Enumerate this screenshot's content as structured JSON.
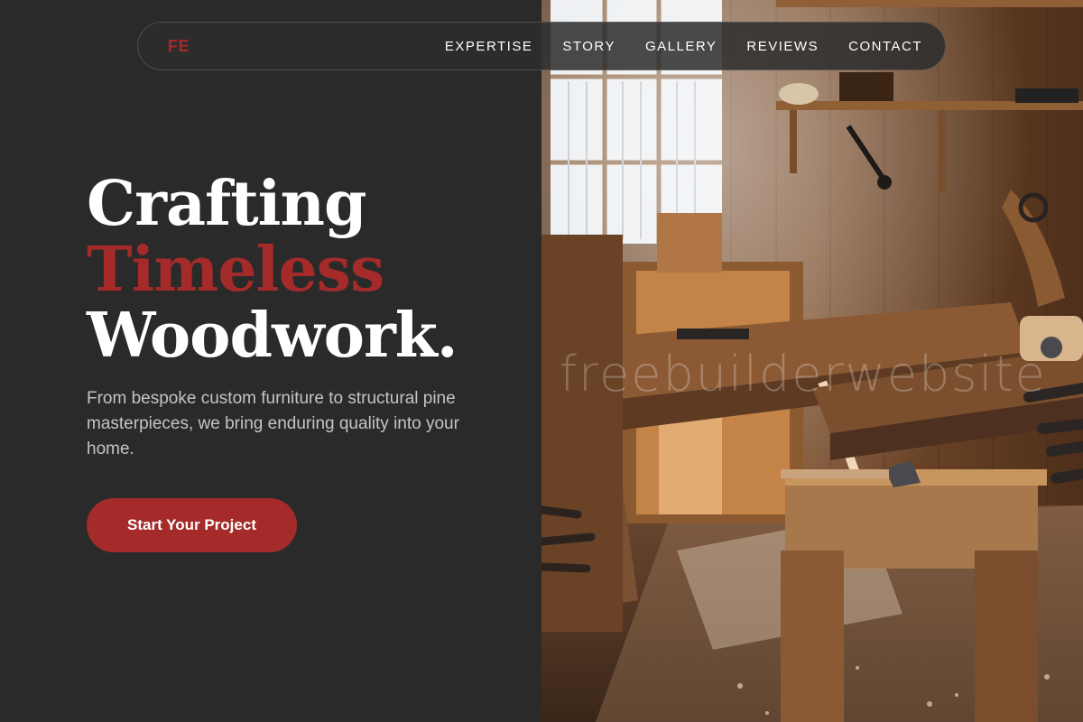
{
  "brand": {
    "logo_text": "FE",
    "accent_color": "#a52a2a"
  },
  "nav": {
    "items": [
      {
        "label": "EXPERTISE"
      },
      {
        "label": "STORY"
      },
      {
        "label": "GALLERY"
      },
      {
        "label": "REVIEWS"
      },
      {
        "label": "CONTACT"
      }
    ]
  },
  "hero": {
    "title_line1": "Crafting",
    "title_line2": "Timeless",
    "title_line3": "Woodwork.",
    "subtitle": "From bespoke custom furniture to structural pine masterpieces, we bring enduring quality into your home.",
    "cta_label": "Start Your Project"
  },
  "photo": {
    "watermark": "freebuilderwebsite"
  },
  "colors": {
    "background": "#2a2a2a",
    "text": "#ffffff",
    "muted_text": "#c4c4c4"
  }
}
